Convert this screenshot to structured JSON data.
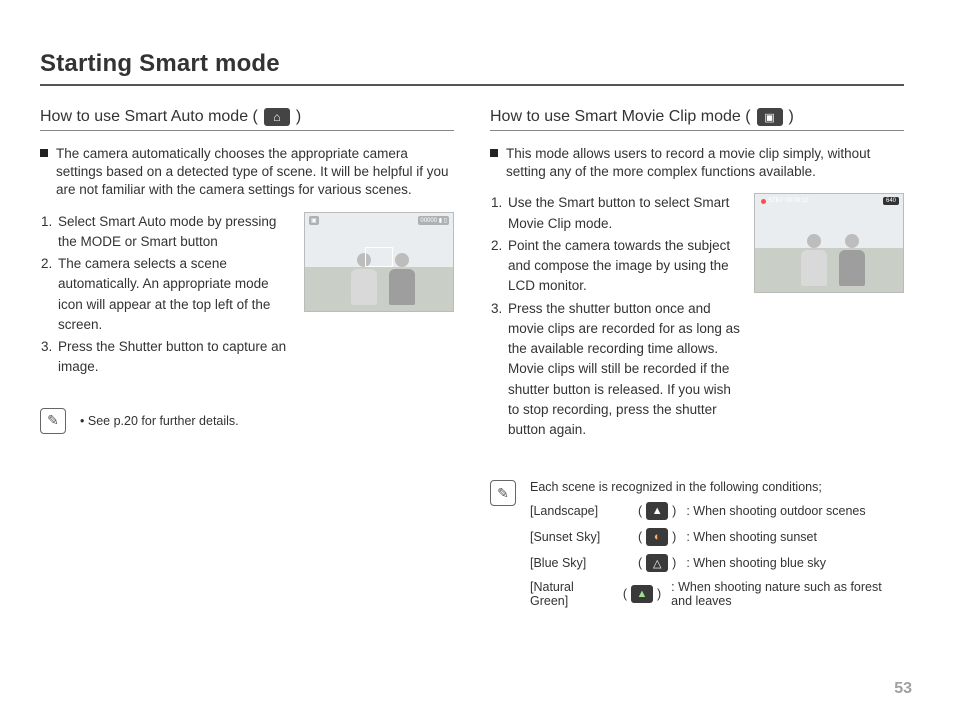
{
  "pageTitle": "Starting Smart mode",
  "pageNumber": "53",
  "left": {
    "heading": "How to use Smart Auto mode (",
    "headingClose": ")",
    "intro": "The camera automatically chooses the appropriate camera settings based on a detected type of scene. It will be helpful if you are not familiar with the camera settings for various scenes.",
    "steps": [
      "Select Smart Auto mode by pressing the MODE or Smart button",
      "The camera selects a scene automatically. An appropriate mode icon will appear at the top left of the screen.",
      "Press the Shutter button to capture an image."
    ],
    "noteBullet": "•",
    "note": "See p.20 for further details."
  },
  "right": {
    "heading": "How to use Smart Movie Clip mode (",
    "headingClose": ")",
    "intro": "This mode allows users to record a movie clip simply, without setting any of the more complex functions available.",
    "steps": [
      "Use the Smart button to select Smart Movie Clip mode.",
      "Point the camera towards the subject and compose the image by using the LCD monitor.",
      "Press the shutter button once and movie clips are recorded for as long as the available recording time allows. Movie clips will still be recorded if the shutter button is released. If you wish to stop recording, press the shutter button again."
    ],
    "recLabel": "STBY 00:00:10",
    "badge": "640",
    "tipIntro": "Each scene is recognized in the following conditions;",
    "scenes": [
      {
        "name": "[Landscape]",
        "icon": "landscape",
        "desc": ": When shooting outdoor scenes"
      },
      {
        "name": "[Sunset Sky]",
        "icon": "sunset",
        "desc": ": When shooting sunset"
      },
      {
        "name": "[Blue Sky]",
        "icon": "bluesky",
        "desc": ": When shooting blue sky"
      },
      {
        "name": "[Natural Green]",
        "icon": "green",
        "desc": ": When shooting nature such as forest and leaves"
      }
    ]
  }
}
